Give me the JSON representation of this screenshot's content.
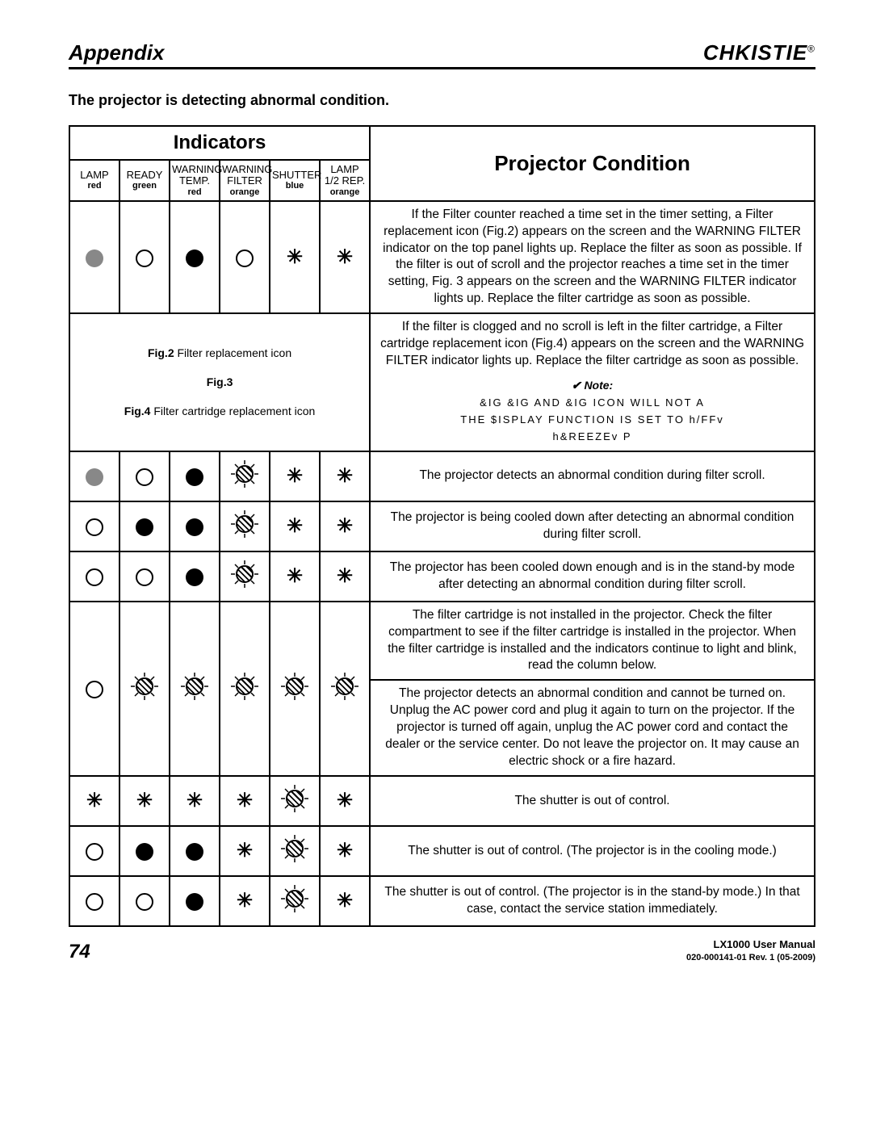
{
  "header": {
    "appendix": "Appendix",
    "brand": "CHKISTIE",
    "brand_reg": "®"
  },
  "subtitle": "The projector is detecting abnormal condition.",
  "table": {
    "indicators_heading": "Indicators",
    "projector_condition_heading": "Projector Condition",
    "columns": [
      {
        "label": "LAMP",
        "sub": "red"
      },
      {
        "label": "READY",
        "sub": "green"
      },
      {
        "label": "WARNING TEMP.",
        "sub": "red"
      },
      {
        "label": "WARNING FILTER",
        "sub": "orange"
      },
      {
        "label": "SHUTTER",
        "sub": "blue"
      },
      {
        "label": "LAMP 1/2 REP.",
        "sub": "orange"
      }
    ]
  },
  "row1_condition": "If the Filter counter reached a time set in the timer setting, a Filter replacement icon (Fig.2) appears on the screen and the WARNING FILTER indicator on the top panel lights up. Replace the filter as soon as possible. If the filter is out of scroll and the projector reaches a time set in the timer setting, Fig. 3 appears on the screen and the WARNING FILTER indicator lights up. Replace the filter cartridge as soon as possible.",
  "row1b_condition": "If the filter is clogged and no scroll is left in the filter cartridge, a Filter cartridge replacement icon (Fig.4) appears on the screen and the WARNING FILTER indicator lights up. Replace the filter cartridge as soon as possible.",
  "fig2_label": "Fig.2",
  "fig2_caption": "Filter replacement icon",
  "fig3_label": "Fig.3",
  "fig4_label": "Fig.4",
  "fig4_caption": "Filter cartridge replacement icon",
  "note_label": "✔ Note:",
  "note_line1": "&IG   &IG  AND &IG  ICON WILL NOT A",
  "note_line2": "THE $ISPLAY FUNCTION IS SET TO h/FFv",
  "note_line3": "h&REEZEv  P",
  "row2_condition": "The projector detects an abnormal condition during filter scroll.",
  "row3_condition": "The projector is being cooled down after detecting an abnormal condition during filter scroll.",
  "row4_condition": "The projector has been cooled down enough and is in the stand-by mode after detecting an abnormal condition during filter scroll.",
  "row5a_condition": "The filter cartridge is not installed in the projector. Check the filter compartment to see if the filter cartridge is installed in the projector. When the filter cartridge is installed and the indicators continue to light and blink, read the column below.",
  "row5b_condition": "The projector detects an abnormal condition and cannot be turned on. Unplug the AC power cord and plug it again to turn on the projector. If the projector is turned off again, unplug the AC power cord and contact the dealer or the service center. Do not leave the projector on. It may cause an electric shock or a fire hazard.",
  "row6_condition": "The shutter is out of control.",
  "row7_condition": "The shutter is out of control. (The projector is in the cooling mode.)",
  "row8_condition": "The shutter is out of control. (The projector is in the stand-by mode.) In that case, contact the service station immediately.",
  "footer": {
    "page": "74",
    "manual": "LX1000 User Manual",
    "rev": "020-000141-01  Rev. 1  (05-2009)"
  }
}
